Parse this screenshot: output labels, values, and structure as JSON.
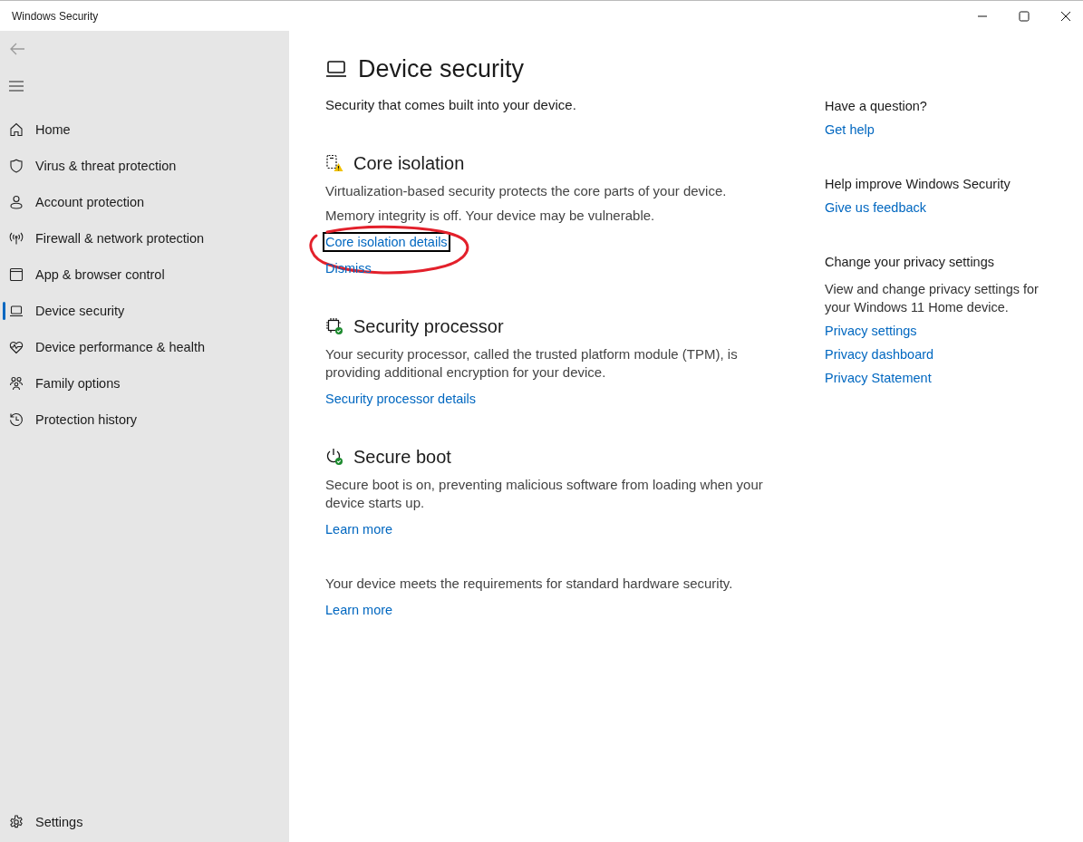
{
  "window": {
    "title": "Windows Security"
  },
  "sidebar": {
    "items": [
      {
        "kind": "home",
        "label": "Home",
        "selected": false
      },
      {
        "kind": "shield",
        "label": "Virus & threat protection",
        "selected": false
      },
      {
        "kind": "person",
        "label": "Account protection",
        "selected": false
      },
      {
        "kind": "antenna",
        "label": "Firewall & network protection",
        "selected": false
      },
      {
        "kind": "window",
        "label": "App & browser control",
        "selected": false
      },
      {
        "kind": "laptop",
        "label": "Device security",
        "selected": true
      },
      {
        "kind": "heart",
        "label": "Device performance & health",
        "selected": false
      },
      {
        "kind": "family",
        "label": "Family options",
        "selected": false
      },
      {
        "kind": "history",
        "label": "Protection history",
        "selected": false
      }
    ],
    "settings": {
      "label": "Settings"
    }
  },
  "page": {
    "title": "Device security",
    "subtitle": "Security that comes built into your device.",
    "sections": [
      {
        "kind": "core",
        "warning": true,
        "heading": "Core isolation",
        "paragraphs": [
          "Virtualization-based security protects the core parts of your device.",
          "Memory integrity is off. Your device may be vulnerable."
        ],
        "links": [
          {
            "label": "Core isolation details",
            "focused": true,
            "circled": true
          },
          {
            "label": "Dismiss",
            "focused": false,
            "circled": false
          }
        ]
      },
      {
        "kind": "chip",
        "warning": false,
        "heading": "Security processor",
        "paragraphs": [
          "Your security processor, called the trusted platform module (TPM), is providing additional encryption for your device."
        ],
        "links": [
          {
            "label": "Security processor details",
            "focused": false,
            "circled": false
          }
        ]
      },
      {
        "kind": "power",
        "warning": false,
        "heading": "Secure boot",
        "paragraphs": [
          "Secure boot is on, preventing malicious software from loading when your device starts up."
        ],
        "links": [
          {
            "label": "Learn more",
            "focused": false,
            "circled": false
          }
        ]
      }
    ],
    "footer": {
      "text": "Your device meets the requirements for standard hardware security.",
      "link": "Learn more"
    }
  },
  "help": {
    "groups": [
      {
        "heading": "Have a question?",
        "links": [
          "Get help"
        ]
      },
      {
        "heading": "Help improve Windows Security",
        "links": [
          "Give us feedback"
        ]
      },
      {
        "heading": "Change your privacy settings",
        "text": "View and change privacy settings for your Windows 11 Home device.",
        "links": [
          "Privacy settings",
          "Privacy dashboard",
          "Privacy Statement"
        ]
      }
    ]
  }
}
